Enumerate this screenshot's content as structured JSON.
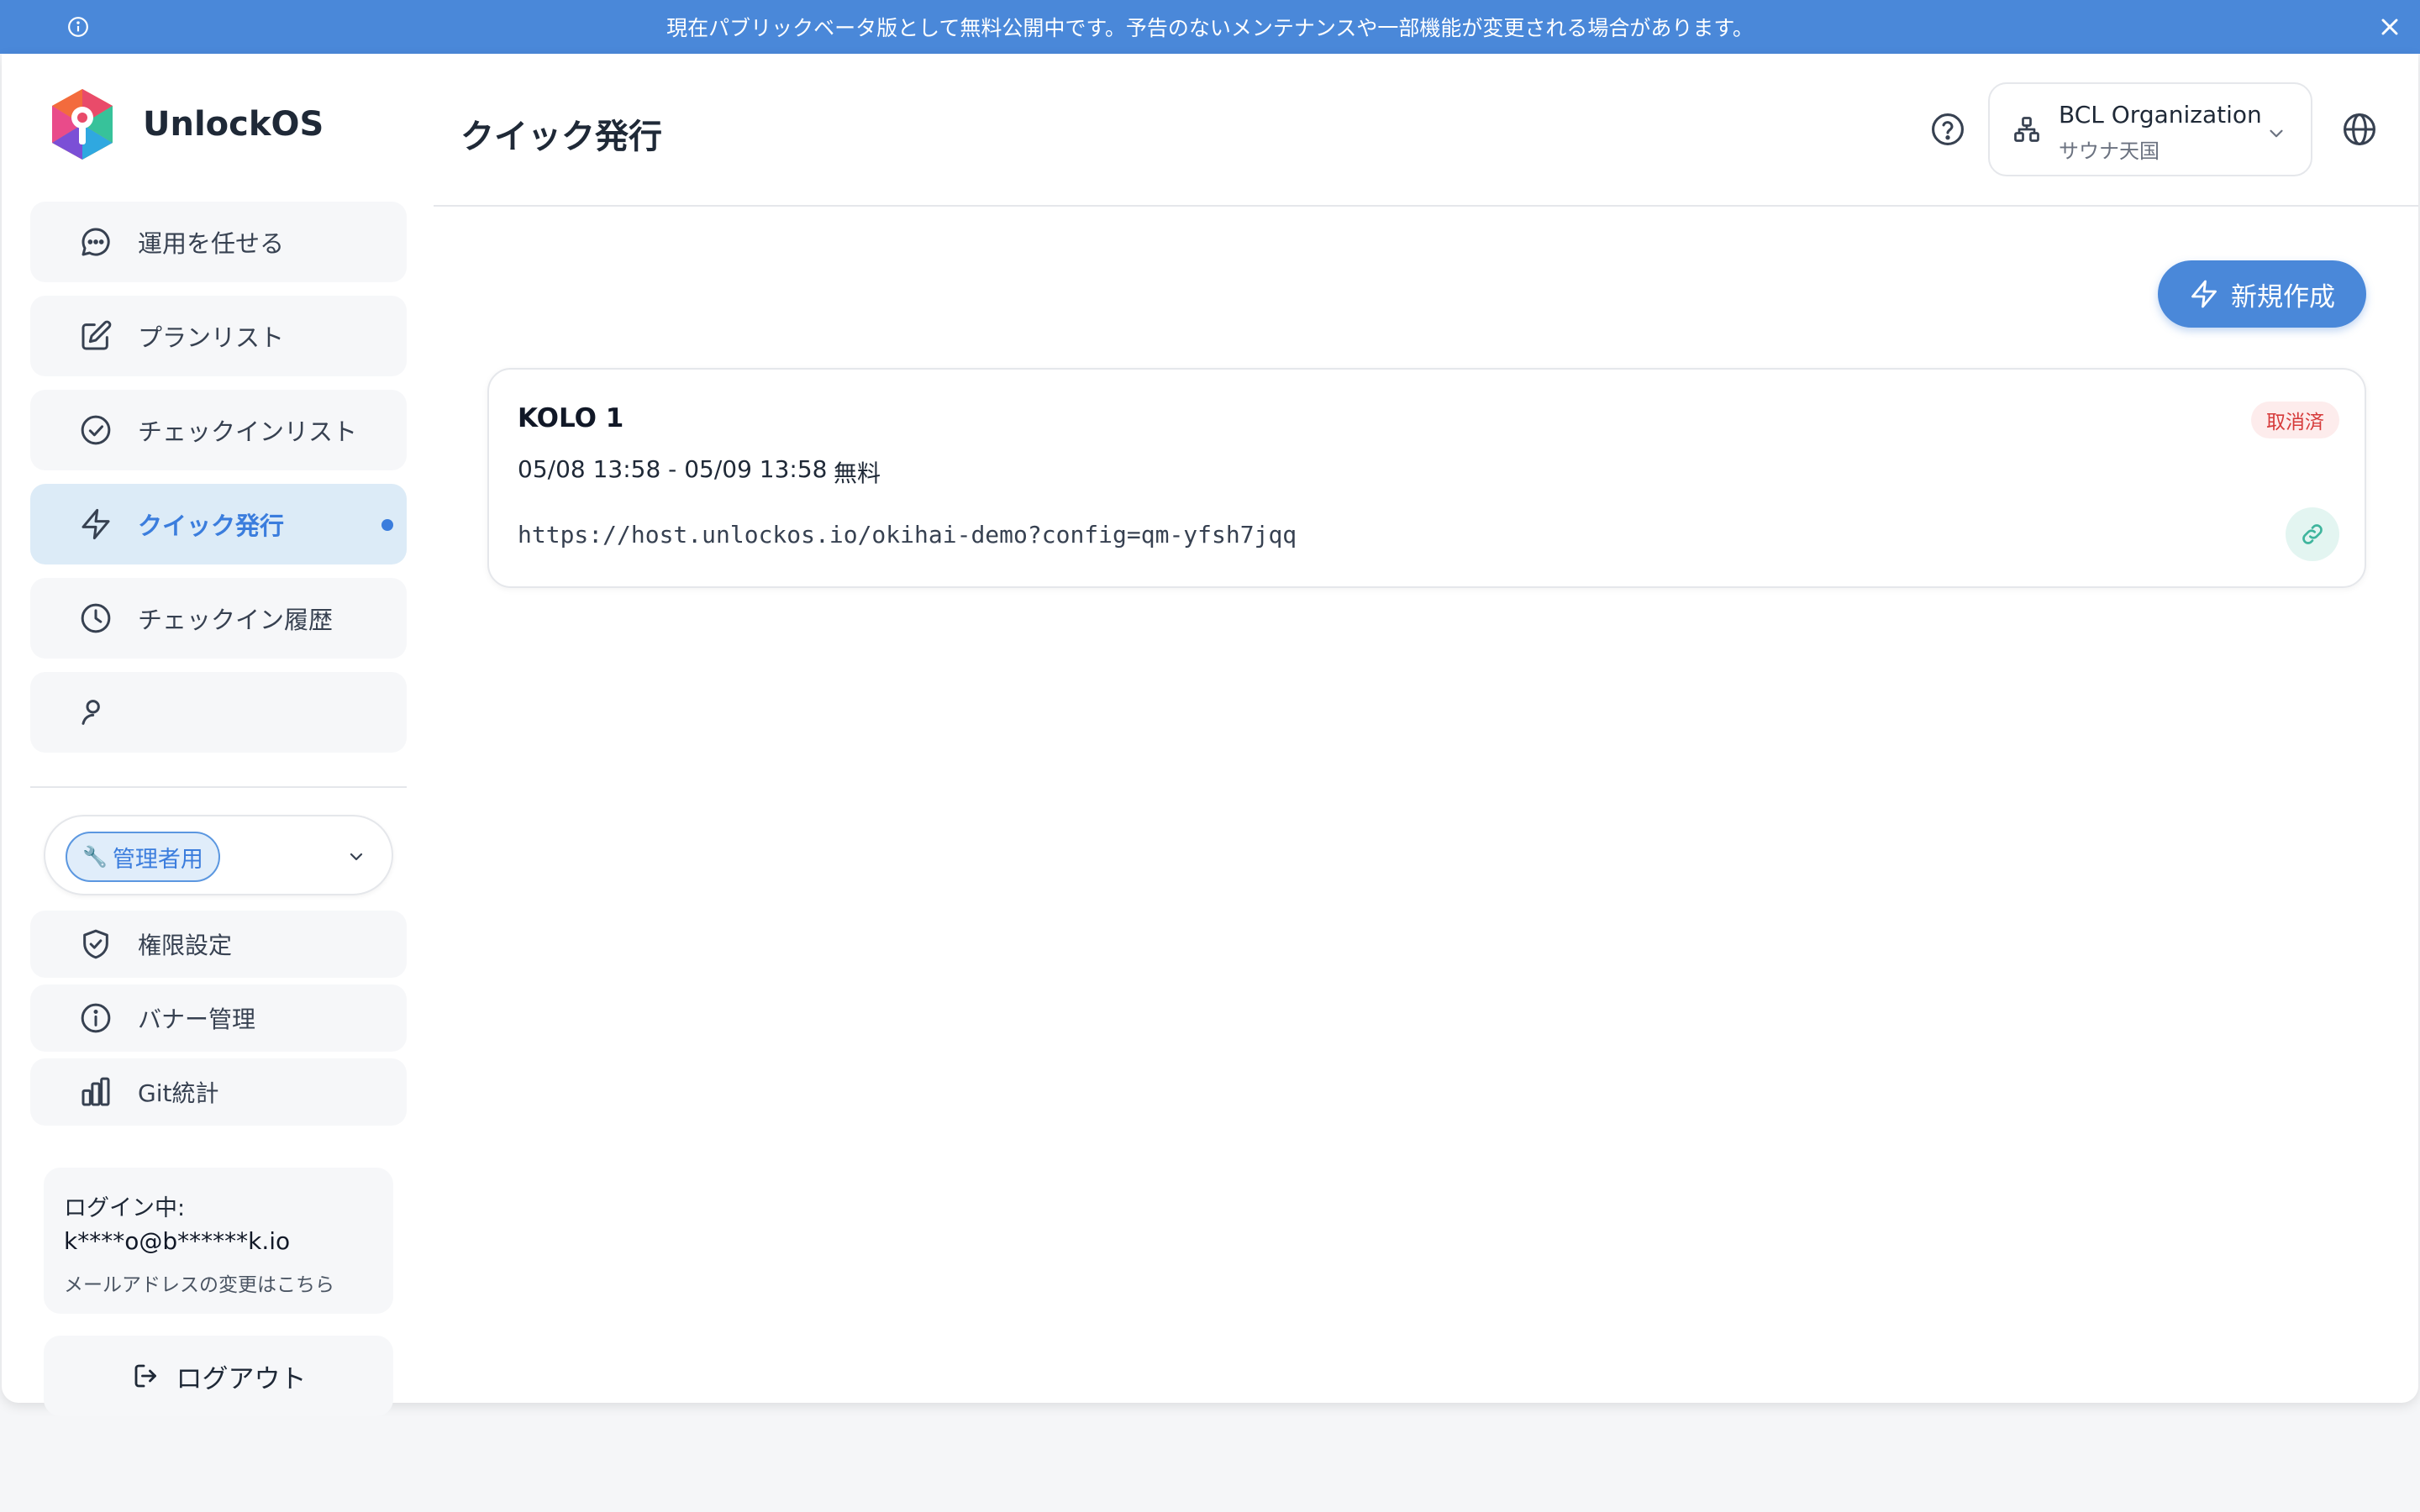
{
  "banner": {
    "text": "現在パブリックベータ版として無料公開中です。予告のないメンテナンスや一部機能が変更される場合があります。",
    "icon": "info-icon",
    "close_icon": "close-icon"
  },
  "brand": {
    "name": "UnlockOS",
    "logo": "unlockos-logo"
  },
  "sidebar": {
    "items": [
      {
        "label": "運用を任せる",
        "icon": "chat-bubble-icon",
        "active": false
      },
      {
        "label": "プランリスト",
        "icon": "edit-icon",
        "active": false
      },
      {
        "label": "チェックインリスト",
        "icon": "check-circle-icon",
        "active": false
      },
      {
        "label": "クイック発行",
        "icon": "bolt-icon",
        "active": true
      },
      {
        "label": "チェックイン履歴",
        "icon": "clock-icon",
        "active": false
      }
    ],
    "admin_select": {
      "label": "管理者用",
      "icon": "wrench-icon"
    },
    "admin_items": [
      {
        "label": "権限設定",
        "icon": "shield-check-icon"
      },
      {
        "label": "バナー管理",
        "icon": "info-icon"
      },
      {
        "label": "Git統計",
        "icon": "bar-chart-icon"
      }
    ],
    "login": {
      "label": "ログイン中:",
      "email": "k****o@b******k.io",
      "change_link": "メールアドレスの変更はこちら"
    },
    "logout_label": "ログアウト"
  },
  "header": {
    "title": "クイック発行",
    "org_name": "BCL Organization",
    "org_sub": "サウナ天国"
  },
  "main": {
    "new_button_label": "新規作成",
    "issues": [
      {
        "title": "KOLO 1",
        "status": "取消済",
        "period": "05/08 13:58 - 05/09 13:58",
        "price": "無料",
        "url": "https://host.unlockos.io/okihai-demo?config=qm-yfsh7jqq"
      }
    ]
  },
  "colors": {
    "accent": "#4a88d9",
    "active_bg": "#dcebf7",
    "status_cancelled": "#d63a3a",
    "link_teal": "#3fb59d"
  }
}
